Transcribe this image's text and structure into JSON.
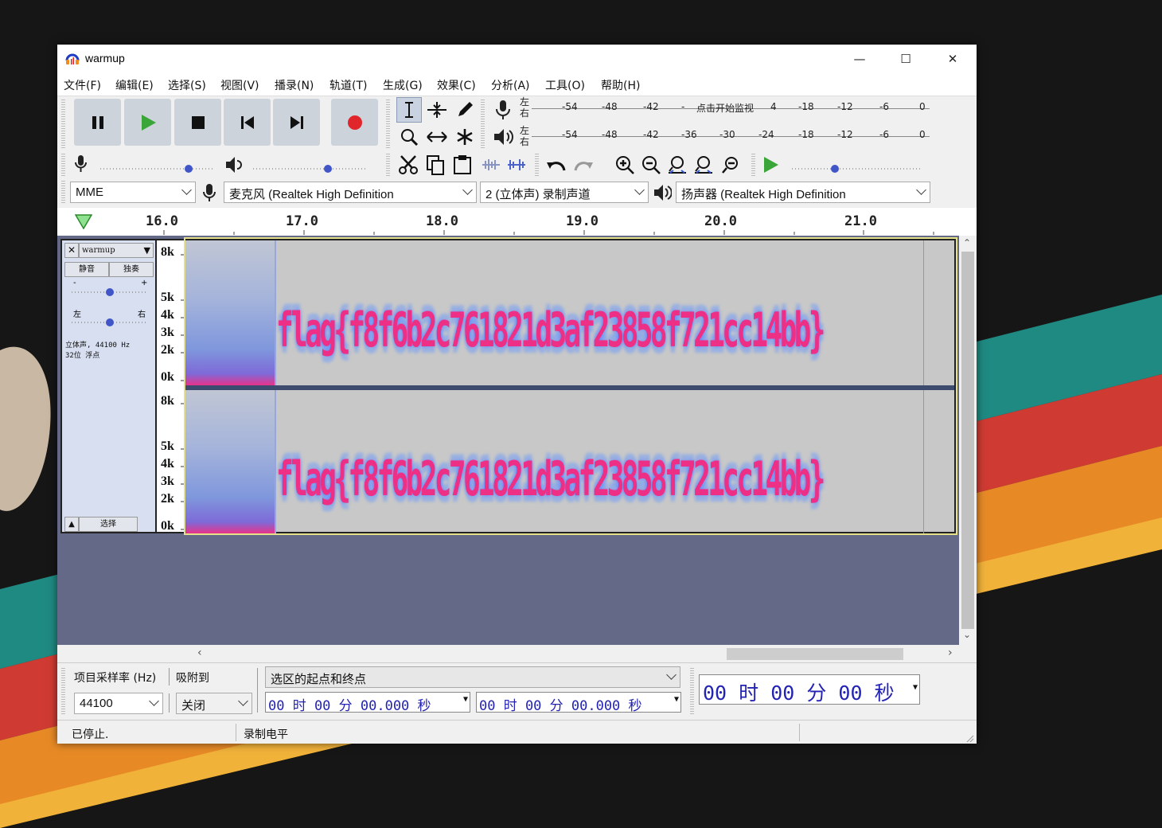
{
  "window": {
    "title": "warmup",
    "minimize_glyph": "—",
    "maximize_glyph": "☐",
    "close_glyph": "✕"
  },
  "menu": [
    "文件(F)",
    "编辑(E)",
    "选择(S)",
    "视图(V)",
    "播录(N)",
    "轨道(T)",
    "生成(G)",
    "效果(C)",
    "分析(A)",
    "工具(O)",
    "帮助(H)"
  ],
  "meters": {
    "rec_scale": [
      "-54",
      "-48",
      "-42",
      "-",
      "-18",
      "-12",
      "-6",
      "0"
    ],
    "rec_prompt": "点击开始监视",
    "rec_prompt_tail": "4",
    "play_scale": [
      "-54",
      "-48",
      "-42",
      "-36",
      "-30",
      "-24",
      "-18",
      "-12",
      "-6",
      "0"
    ],
    "channel_l": "左",
    "channel_r": "右"
  },
  "device": {
    "host": "MME",
    "input": "麦克风 (Realtek High Definition",
    "channels": "2 (立体声) 录制声道",
    "output": "扬声器 (Realtek High Definition"
  },
  "ruler": {
    "ticks": [
      "16.0",
      "17.0",
      "18.0",
      "19.0",
      "20.0",
      "21.0"
    ]
  },
  "track": {
    "name": "warmup",
    "mute": "静音",
    "solo": "独奏",
    "gain_minus": "-",
    "gain_plus": "+",
    "pan_left": "左",
    "pan_right": "右",
    "info_line1": "立体声, 44100 Hz",
    "info_line2": "32位 浮点",
    "select": "选择",
    "freq_labels": [
      "8k",
      "5k",
      "4k",
      "3k",
      "2k",
      "0k"
    ],
    "spectrogram_text": "flag{f8f6b2c761821d3af23858f721cc14bb}"
  },
  "selection": {
    "rate_label": "项目采样率 (Hz)",
    "snap_label": "吸附到",
    "rate_value": "44100",
    "snap_value": "关闭",
    "mode": "选区的起点和终点",
    "start": "00 时 00 分 00.000 秒",
    "end": "00 时 00 分 00.000 秒",
    "position": "00 时 00 分 00 秒"
  },
  "status": {
    "state": "已停止.",
    "level": "录制电平"
  },
  "colors": {
    "accent": "#2323b4",
    "spectrogram_text": "#ee2f86",
    "record": "#e0262a",
    "play": "#3aa63a"
  }
}
